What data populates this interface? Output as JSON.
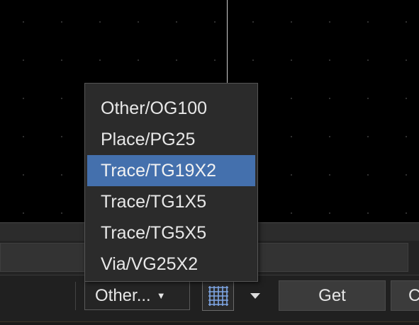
{
  "colors": {
    "canvas_bg": "#000000",
    "menu_bg": "#2b2b2b",
    "menu_selected": "#4470ad",
    "text": "#e8e8e8",
    "grid_icon": "#7fa7e6"
  },
  "grid_menu": {
    "items": [
      {
        "label": "Other/OG100",
        "selected": false
      },
      {
        "label": "Place/PG25",
        "selected": false
      },
      {
        "label": "Trace/TG19X2",
        "selected": true
      },
      {
        "label": "Trace/TG1X5",
        "selected": false
      },
      {
        "label": "Trace/TG5X5",
        "selected": false
      },
      {
        "label": "Via/VG25X2",
        "selected": false
      }
    ]
  },
  "toolbar": {
    "grid_select_value": "Other...",
    "grid_select_icon": "chevron-down-icon",
    "grid_toggle_icon": "grid-icon",
    "grid_dropdown_icon": "triangle-down-icon",
    "get_label": "Get",
    "next_label": "C"
  }
}
